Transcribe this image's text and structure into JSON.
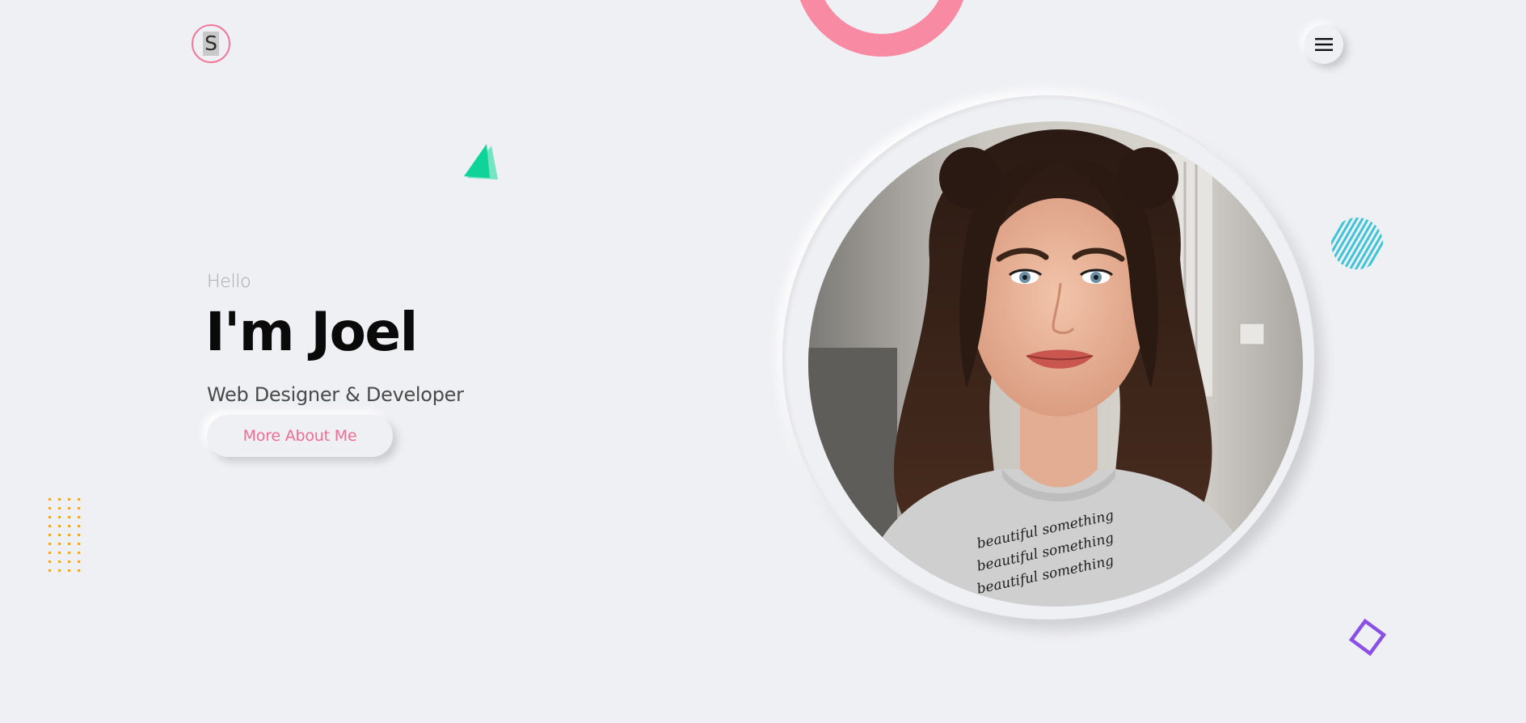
{
  "logo": {
    "letter": "S"
  },
  "menu": {
    "icon": "hamburger-icon"
  },
  "hero": {
    "greeting": "Hello",
    "name": "I'm Joel",
    "role": "Web Designer & Developer",
    "cta_label": "More About Me"
  },
  "portrait": {
    "shirt_lines": [
      "beautiful something",
      "beautiful something",
      "beautiful something"
    ]
  },
  "colors": {
    "background": "#eff0f4",
    "accent_pink": "#f2789b",
    "cta_text": "#f06d93",
    "green": "#15d59a",
    "cyan": "#3ec4d8",
    "orange": "#f5a623",
    "purple": "#8a4fe8"
  },
  "decorations": [
    "pink-ring",
    "green-triangle",
    "cyan-striped-circle",
    "orange-dot-grid",
    "purple-square-outline"
  ]
}
